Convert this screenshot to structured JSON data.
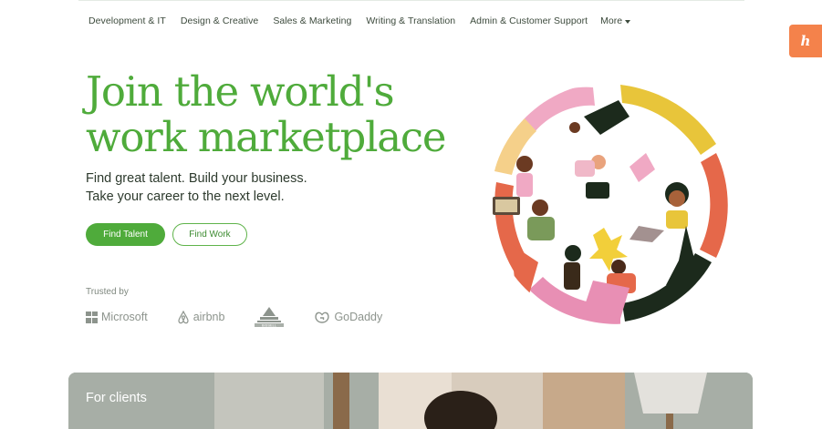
{
  "nav": {
    "categories": [
      "Development & IT",
      "Design & Creative",
      "Sales & Marketing",
      "Writing & Translation",
      "Admin & Customer Support"
    ],
    "more_label": "More"
  },
  "honey": {
    "glyph": "h"
  },
  "hero": {
    "title_line1": "Join the world's",
    "title_line2": "work marketplace",
    "sub_line1": "Find great talent. Build your business.",
    "sub_line2": "Take your career to the next level.",
    "find_talent_label": "Find Talent",
    "find_work_label": "Find Work"
  },
  "trusted": {
    "label": "Trusted by",
    "logos": [
      "Microsoft",
      "airbnb",
      "BISSELL",
      "GoDaddy"
    ]
  },
  "card": {
    "label": "For clients"
  },
  "colors": {
    "brand_green": "#4fab3b",
    "honey_orange": "#f4824b",
    "text_dark": "#2d3a2d"
  }
}
